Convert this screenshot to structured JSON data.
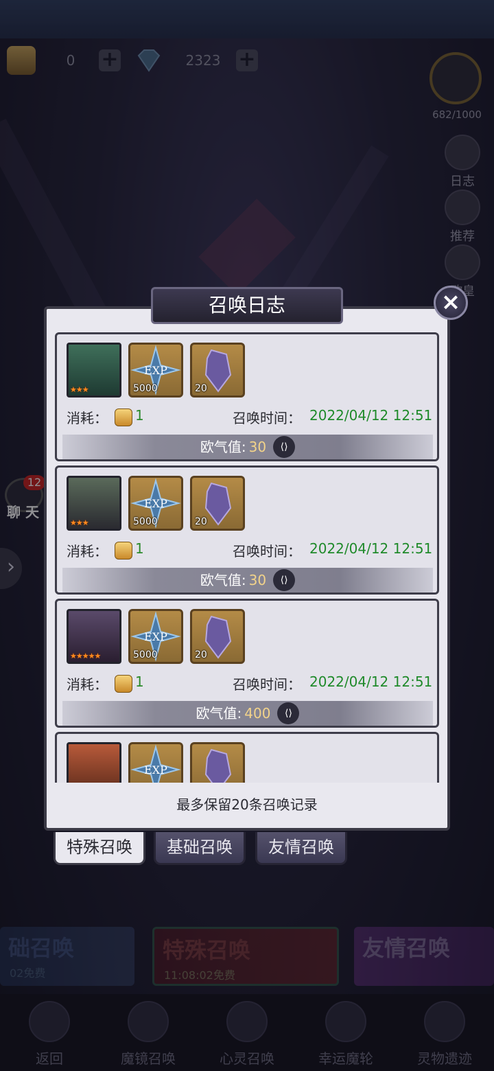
{
  "resources": [
    {
      "icon": "summon-scroll-icon",
      "value": "0"
    },
    {
      "icon": "diamond-icon",
      "value": "2323"
    }
  ],
  "side_menu": {
    "progress_label": "682/1000",
    "progress_fraction": 0.682,
    "items": [
      {
        "icon": "log-scroll-icon",
        "label": "日志"
      },
      {
        "icon": "recommend-knight-icon",
        "label": "推荐"
      },
      {
        "icon": "luck-king-icon",
        "label": "欧皇"
      }
    ]
  },
  "modal": {
    "title": "召唤日志",
    "close_icon": "close-x-icon",
    "entries": [
      {
        "hero_stars": "★★★",
        "items": [
          {
            "icon": "exp-icon",
            "qty": "5000"
          },
          {
            "icon": "crystal-icon",
            "qty": "20"
          }
        ],
        "cost_label": "消耗：",
        "cost_value": "1",
        "time_label": "召唤时间：",
        "time_value": "2022/04/12 12:51",
        "luck_label": "欧气值:",
        "luck_value": "30"
      },
      {
        "hero_stars": "★★★",
        "items": [
          {
            "icon": "exp-icon",
            "qty": "5000"
          },
          {
            "icon": "crystal-icon",
            "qty": "20"
          }
        ],
        "cost_label": "消耗：",
        "cost_value": "1",
        "time_label": "召唤时间：",
        "time_value": "2022/04/12 12:51",
        "luck_label": "欧气值:",
        "luck_value": "30"
      },
      {
        "hero_stars": "★★★★★",
        "items": [
          {
            "icon": "exp-icon",
            "qty": "5000"
          },
          {
            "icon": "crystal-icon",
            "qty": "20"
          }
        ],
        "cost_label": "消耗：",
        "cost_value": "1",
        "time_label": "召唤时间：",
        "time_value": "2022/04/12 12:51",
        "luck_label": "欧气值:",
        "luck_value": "400"
      },
      {
        "hero_stars": "",
        "items": [
          {
            "icon": "exp-icon",
            "qty": ""
          },
          {
            "icon": "crystal-icon",
            "qty": ""
          }
        ],
        "cost_label": "",
        "cost_value": "",
        "time_label": "",
        "time_value": "",
        "luck_label": "",
        "luck_value": ""
      }
    ],
    "footer_note": "最多保留20条召唤记录"
  },
  "tabs": [
    {
      "label": "特殊召唤",
      "active": true
    },
    {
      "label": "基础召唤",
      "active": false
    },
    {
      "label": "友情召唤",
      "active": false
    }
  ],
  "banners": [
    {
      "title": "础召唤",
      "subtitle": "02免费"
    },
    {
      "title": "特殊召唤",
      "subtitle": "11:08:02免费"
    },
    {
      "title": "友情召唤",
      "subtitle": ""
    }
  ],
  "chat": {
    "badge": "12",
    "label": "聊 天"
  },
  "bottom_nav": [
    {
      "icon": "back-icon",
      "label": "返回"
    },
    {
      "icon": "magic-mirror-icon",
      "label": "魔镜召唤"
    },
    {
      "icon": "soul-summon-icon",
      "label": "心灵召唤"
    },
    {
      "icon": "lucky-wheel-icon",
      "label": "幸运魔轮"
    },
    {
      "icon": "relic-icon",
      "label": "灵物遗迹"
    }
  ],
  "colors": {
    "modal_bg": "#e9e8ef",
    "time_green": "#1f8a2a",
    "luck_gold": "#f2d38a",
    "badge_red": "#c9221f"
  }
}
